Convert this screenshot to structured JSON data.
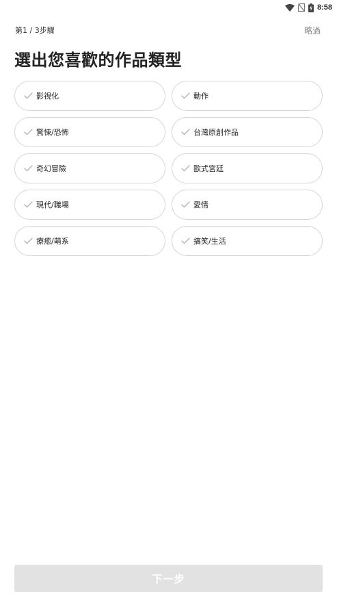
{
  "status_bar": {
    "time": "8:58",
    "icons": [
      "wifi-icon",
      "no-sim-icon",
      "battery-charging-icon"
    ]
  },
  "header": {
    "step_label": "第1 / 3步驟",
    "skip_label": "略過",
    "title": "選出您喜歡的作品類型"
  },
  "genres": [
    {
      "label": "影視化",
      "selected": false
    },
    {
      "label": "動作",
      "selected": false
    },
    {
      "label": "驚悚/恐怖",
      "selected": false
    },
    {
      "label": "台灣原創作品",
      "selected": false
    },
    {
      "label": "奇幻冒險",
      "selected": false
    },
    {
      "label": "歐式宮廷",
      "selected": false
    },
    {
      "label": "現代/職場",
      "selected": false
    },
    {
      "label": "愛情",
      "selected": false
    },
    {
      "label": "療癒/萌系",
      "selected": false
    },
    {
      "label": "搞笑/生活",
      "selected": false
    }
  ],
  "footer": {
    "next_label": "下一步",
    "enabled": false
  },
  "colors": {
    "chip_border": "#d6d6d6",
    "check_mark": "#b5b5b5",
    "disabled_button": "#e2e2e2",
    "skip_text": "#8a8a8a"
  }
}
